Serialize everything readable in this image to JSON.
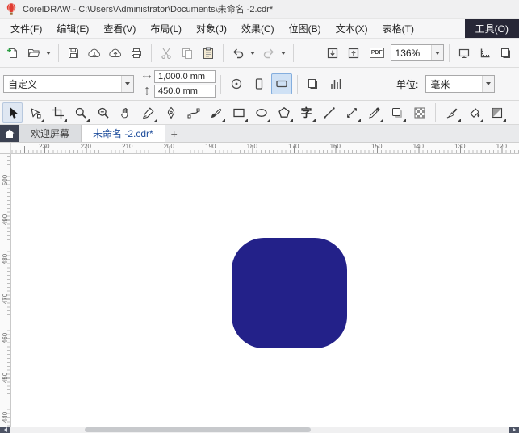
{
  "window": {
    "title": "CorelDRAW - C:\\Users\\Administrator\\Documents\\未命名 -2.cdr*"
  },
  "menubar": {
    "items": [
      "文件(F)",
      "编辑(E)",
      "查看(V)",
      "布局(L)",
      "对象(J)",
      "效果(C)",
      "位图(B)",
      "文本(X)",
      "表格(T)",
      "工具(O)"
    ]
  },
  "toolbar": {
    "zoom_level": "136%",
    "pdf_label": "PDF"
  },
  "property_bar": {
    "preset": "自定义",
    "page_width": "1,000.0 mm",
    "page_height": "450.0 mm",
    "units_label": "单位:",
    "units_value": "毫米"
  },
  "toolbox": {
    "text_tool_glyph": "字"
  },
  "tabs": {
    "items": [
      {
        "label": "欢迎屏幕"
      },
      {
        "label": "未命名 -2.cdr*"
      }
    ],
    "new_tab_label": "+"
  },
  "rulers": {
    "horizontal": [
      "230",
      "220",
      "210",
      "200",
      "190",
      "180",
      "170",
      "160",
      "150",
      "140",
      "130",
      "120"
    ],
    "vertical": [
      "500",
      "490",
      "480",
      "470",
      "460",
      "450",
      "440"
    ]
  },
  "canvas": {
    "shape_color": "#232189"
  }
}
